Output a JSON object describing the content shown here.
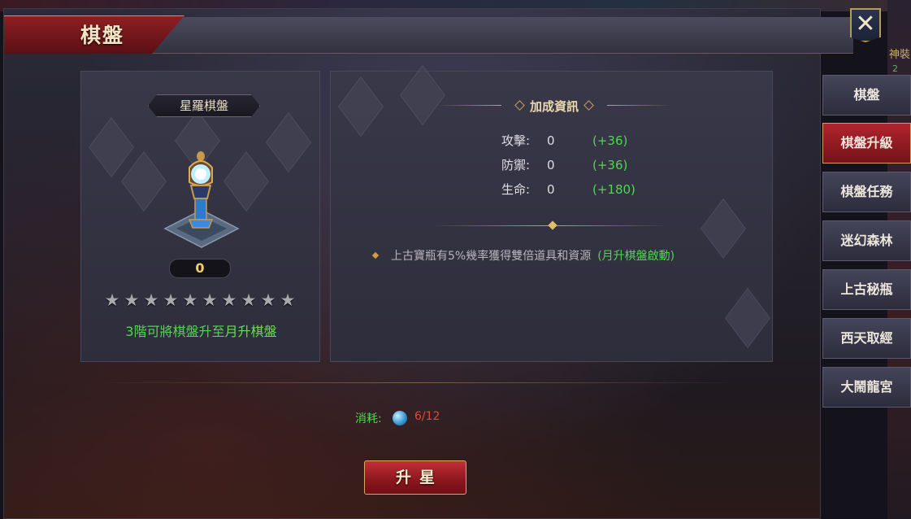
{
  "window": {
    "title": "棋盤",
    "close_label": "✕"
  },
  "background": {
    "fragment_text": "神裝",
    "fragment_num": "2"
  },
  "board_panel": {
    "name": "星羅棋盤",
    "level": "0",
    "stars_total": 10,
    "stars_filled": 0,
    "hint_prefix": "3階可將棋盤升至",
    "hint_target": "月升棋盤"
  },
  "bonus_panel": {
    "title": "加成資訊",
    "stats": [
      {
        "label": "攻擊:",
        "value": "0",
        "bonus": "(+36)"
      },
      {
        "label": "防禦:",
        "value": "0",
        "bonus": "(+36)"
      },
      {
        "label": "生命:",
        "value": "0",
        "bonus": "(+180)"
      }
    ],
    "effect_text": "上古寶瓶有5%幾率獲得雙倍道具和資源",
    "effect_note": "(月升棋盤啟動)"
  },
  "cost": {
    "label": "消耗:",
    "icon": "blue-orb-icon",
    "value": "6/12"
  },
  "action": {
    "star_up_label": "升星"
  },
  "side_tabs": [
    {
      "label": "棋盤",
      "active": false
    },
    {
      "label": "棋盤升級",
      "active": true
    },
    {
      "label": "棋盤任務",
      "active": false
    },
    {
      "label": "迷幻森林",
      "active": false
    },
    {
      "label": "上古秘瓶",
      "active": false
    },
    {
      "label": "西天取經",
      "active": false
    },
    {
      "label": "大鬧龍宮",
      "active": false
    }
  ],
  "colors": {
    "accent_red": "#8e1e24",
    "bonus_green": "#4fd74f",
    "cost_red": "#e04a3a",
    "gold": "#c8a05a"
  }
}
